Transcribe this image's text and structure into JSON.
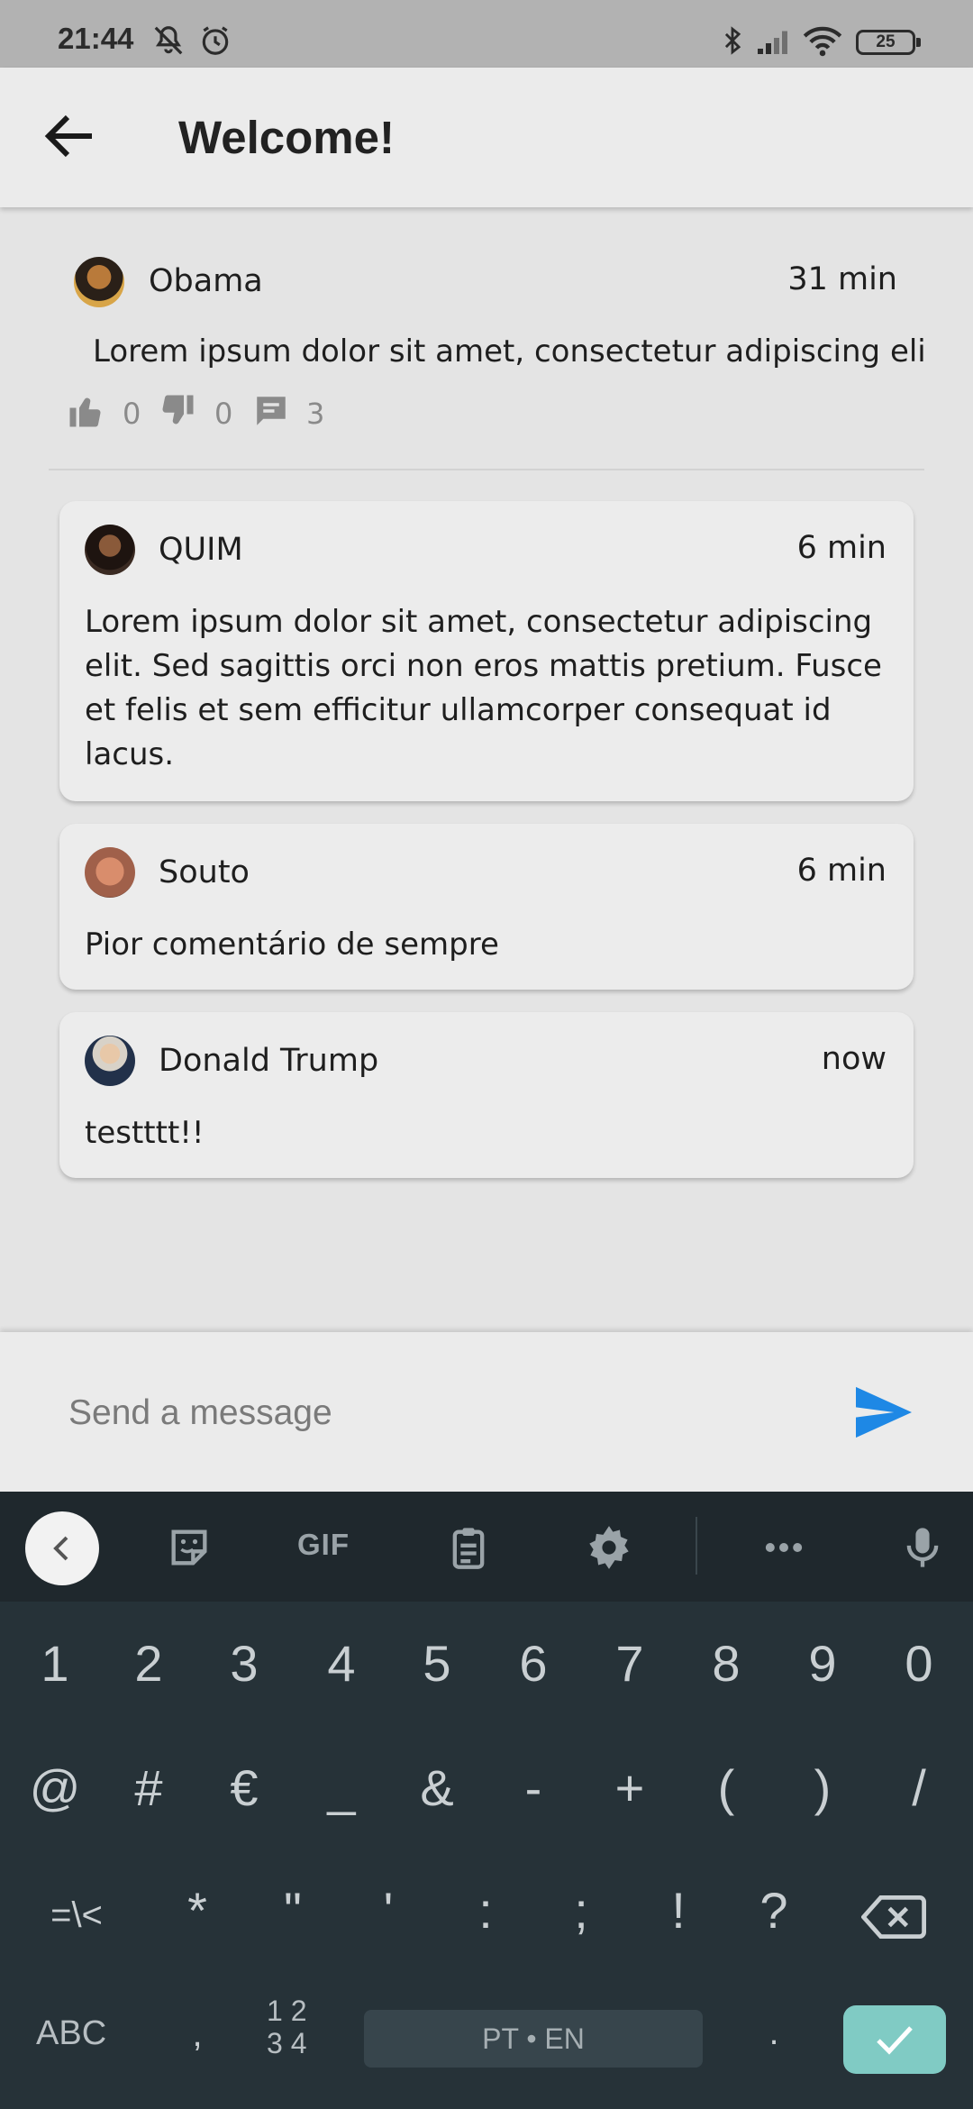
{
  "status_bar": {
    "time": "21:44",
    "battery": "25"
  },
  "app_bar": {
    "title": "Welcome!"
  },
  "post": {
    "author": "Obama",
    "time": "31 min",
    "text": "Lorem ipsum dolor sit amet, consectetur adipiscing eli",
    "likes": "0",
    "dislikes": "0",
    "comments": "3"
  },
  "comments": [
    {
      "author": "QUIM",
      "time": "6 min",
      "text": "Lorem ipsum dolor sit amet, consectetur adipiscing elit. Sed sagittis orci non eros mattis pretium. Fusce et felis et sem efficitur ullamcorper consequat id lacus."
    },
    {
      "author": "Souto",
      "time": "6 min",
      "text": "Pior comentário de sempre"
    },
    {
      "author": "Donald Trump",
      "time": "now",
      "text": "testttt!!"
    }
  ],
  "input": {
    "placeholder": "Send a message"
  },
  "keyboard": {
    "gif": "GIF",
    "row1": [
      "1",
      "2",
      "3",
      "4",
      "5",
      "6",
      "7",
      "8",
      "9",
      "0"
    ],
    "row2": [
      "@",
      "#",
      "€",
      "_",
      "&",
      "-",
      "+",
      "(",
      ")",
      "/"
    ],
    "row3": [
      "=\\<",
      "*",
      "\"",
      "'",
      ":",
      ";",
      "!",
      "?"
    ],
    "abc": "ABC",
    "comma": ",",
    "num_top": "1 2",
    "num_bottom": "3 4",
    "space": "PT • EN",
    "period": "."
  },
  "colors": {
    "accent": "#1e88e5",
    "enter": "#80cbc4",
    "keyboard_bg": "#263238"
  }
}
